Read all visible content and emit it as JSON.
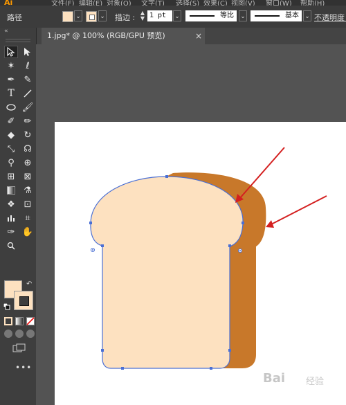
{
  "menubar": {
    "logo": "Ai",
    "items": [
      "文件(F)",
      "编辑(E)",
      "对象(O)",
      "文字(T)",
      "选择(S)",
      "效果(C)",
      "视图(V)",
      "窗口(W)",
      "帮助(H)"
    ]
  },
  "control_bar": {
    "path_label": "路径",
    "fill_color": "#fde1c0",
    "stroke_label": "描边 :",
    "stroke_weight": "1 pt",
    "profile_label": "等比",
    "brush_label": "基本",
    "opacity_label": "不透明度 :"
  },
  "tab": {
    "title": "1.jpg* @ 100% (RGB/GPU 预览)",
    "close": "×"
  },
  "tools": [
    "selection-tool",
    "direct-selection-tool",
    "magic-wand-tool",
    "lasso-tool",
    "pen-tool",
    "curvature-tool",
    "type-tool",
    "line-segment-tool",
    "ellipse-tool",
    "paintbrush-tool",
    "shaper-tool",
    "pencil-tool",
    "eraser-tool",
    "rotate-tool",
    "scale-tool",
    "warp-tool",
    "puppet-warp-tool",
    "shape-builder-tool",
    "perspective-grid-tool",
    "mesh-tool",
    "gradient-tool",
    "eyedropper-tool",
    "symbol-sprayer-tool",
    "artboard-crop-tool",
    "column-graph-tool",
    "slice-tool",
    "hand-tool",
    "zoom-tool"
  ],
  "colors": {
    "bread_fill": "#fde1c0",
    "bread_shadow": "#c8782a",
    "path_blue": "#4a6fd4",
    "arrow_red": "#d42020"
  },
  "watermark": {
    "text": "Bai",
    "sub": "经验"
  },
  "more_label": "•••"
}
